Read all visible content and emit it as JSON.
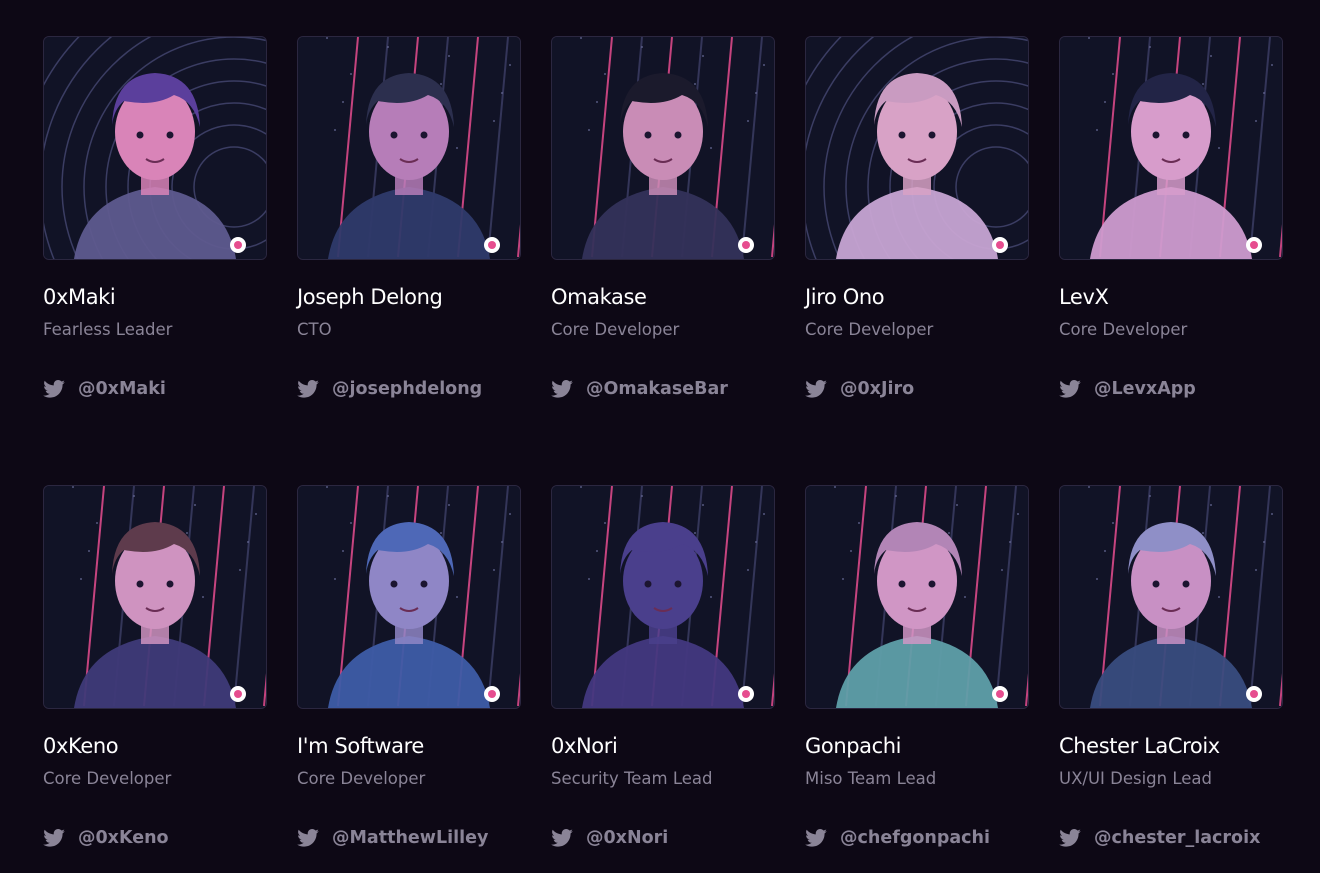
{
  "colors": {
    "background": "#0d0815",
    "card_border": "#2b2740",
    "name": "#ffffff",
    "muted": "#8a8497",
    "accent_pink": "#e64d8f"
  },
  "team": [
    {
      "name": "0xMaki",
      "role": "Fearless Leader",
      "twitter": "@0xMaki",
      "icon": "twitter-icon",
      "bg": "rings",
      "skin": "#d984b8",
      "hair": "#5b3f9c",
      "shirt": "#5e5a8e"
    },
    {
      "name": "Joseph Delong",
      "role": "CTO",
      "twitter": "@josephdelong",
      "icon": "twitter-icon",
      "bg": "stripes",
      "skin": "#b67db8",
      "hair": "#2c2f4e",
      "shirt": "#2f3a6a"
    },
    {
      "name": "Omakase",
      "role": "Core Developer",
      "twitter": "@OmakaseBar",
      "icon": "twitter-icon",
      "bg": "stripes",
      "skin": "#c98cb6",
      "hair": "#1b1a2c",
      "shirt": "#34325a"
    },
    {
      "name": "Jiro Ono",
      "role": "Core Developer",
      "twitter": "@0xJiro",
      "icon": "twitter-icon",
      "bg": "rings",
      "skin": "#d8a2c6",
      "hair": "#c99bc1",
      "shirt": "#c7a4d3"
    },
    {
      "name": "LevX",
      "role": "Core Developer",
      "twitter": "@LevxApp",
      "icon": "twitter-icon",
      "bg": "stripes",
      "skin": "#d79ccb",
      "hair": "#222446",
      "shirt": "#cf9bcf"
    },
    {
      "name": "0xKeno",
      "role": "Core Developer",
      "twitter": "@0xKeno",
      "icon": "twitter-icon",
      "bg": "stripes",
      "skin": "#cf93c0",
      "hair": "#5e3b4c",
      "shirt": "#3f3a78"
    },
    {
      "name": "I'm Software",
      "role": "Core Developer",
      "twitter": "@MatthewLilley",
      "icon": "twitter-icon",
      "bg": "stripes",
      "skin": "#8f86c6",
      "hair": "#4e68b7",
      "shirt": "#3e5ca6"
    },
    {
      "name": "0xNori",
      "role": "Security Team Lead",
      "twitter": "@0xNori",
      "icon": "twitter-icon",
      "bg": "stripes",
      "skin": "#4a3f8c",
      "hair": "#4a3f8c",
      "shirt": "#43387f"
    },
    {
      "name": "Gonpachi",
      "role": "Miso Team Lead",
      "twitter": "@chefgonpachi",
      "icon": "twitter-icon",
      "bg": "stripes",
      "skin": "#d096c5",
      "hair": "#b285b6",
      "shirt": "#5f9fa9"
    },
    {
      "name": "Chester LaCroix",
      "role": "UX/UI Design Lead",
      "twitter": "@chester_lacroix",
      "icon": "twitter-icon",
      "bg": "stripes",
      "skin": "#c890c4",
      "hair": "#8f8fc7",
      "shirt": "#394c7e"
    }
  ]
}
